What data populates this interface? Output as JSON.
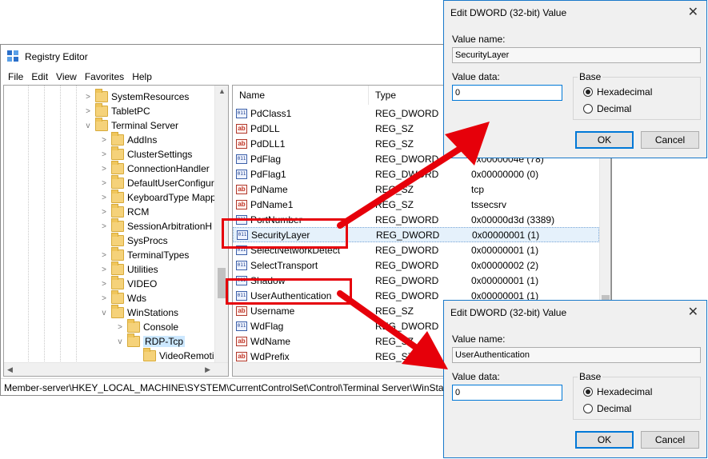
{
  "window": {
    "title": "Registry Editor"
  },
  "menu": [
    "File",
    "Edit",
    "View",
    "Favorites",
    "Help"
  ],
  "tree": {
    "items": [
      {
        "label": "SystemResources",
        "chev": ">"
      },
      {
        "label": "TabletPC",
        "chev": ">"
      },
      {
        "label": "Terminal Server",
        "chev": "v"
      },
      {
        "label": "AddIns",
        "chev": ">"
      },
      {
        "label": "ClusterSettings",
        "chev": ">"
      },
      {
        "label": "ConnectionHandler",
        "chev": ">"
      },
      {
        "label": "DefaultUserConfigur",
        "chev": ">"
      },
      {
        "label": "KeyboardType Mapp",
        "chev": ">"
      },
      {
        "label": "RCM",
        "chev": ">"
      },
      {
        "label": "SessionArbitrationH",
        "chev": ">"
      },
      {
        "label": "SysProcs",
        "chev": ""
      },
      {
        "label": "TerminalTypes",
        "chev": ">"
      },
      {
        "label": "Utilities",
        "chev": ">"
      },
      {
        "label": "VIDEO",
        "chev": ">"
      },
      {
        "label": "Wds",
        "chev": ">"
      },
      {
        "label": "WinStations",
        "chev": "v"
      },
      {
        "label": "Console",
        "chev": ">"
      },
      {
        "label": "RDP-Tcp",
        "chev": "v"
      },
      {
        "label": "VideoRemoti",
        "chev": ""
      }
    ]
  },
  "list": {
    "columns": [
      "Name",
      "Type"
    ],
    "rows": [
      {
        "icon": "binary",
        "name": "PdClass1",
        "type": "REG_DWORD",
        "data": ""
      },
      {
        "icon": "string",
        "name": "PdDLL",
        "type": "REG_SZ",
        "data": ""
      },
      {
        "icon": "string",
        "name": "PdDLL1",
        "type": "REG_SZ",
        "data": ""
      },
      {
        "icon": "binary",
        "name": "PdFlag",
        "type": "REG_DWORD",
        "data": "0x0000004e (78)"
      },
      {
        "icon": "binary",
        "name": "PdFlag1",
        "type": "REG_DWORD",
        "data": "0x00000000 (0)"
      },
      {
        "icon": "string",
        "name": "PdName",
        "type": "REG_SZ",
        "data": "tcp"
      },
      {
        "icon": "string",
        "name": "PdName1",
        "type": "REG_SZ",
        "data": "tssecsrv"
      },
      {
        "icon": "binary",
        "name": "PortNumber",
        "type": "REG_DWORD",
        "data": "0x00000d3d (3389)"
      },
      {
        "icon": "binary",
        "name": "SecurityLayer",
        "type": "REG_DWORD",
        "data": "0x00000001 (1)"
      },
      {
        "icon": "binary",
        "name": "SelectNetworkDetect",
        "type": "REG_DWORD",
        "data": "0x00000001 (1)"
      },
      {
        "icon": "binary",
        "name": "SelectTransport",
        "type": "REG_DWORD",
        "data": "0x00000002 (2)"
      },
      {
        "icon": "binary",
        "name": "Shadow",
        "type": "REG_DWORD",
        "data": "0x00000001 (1)"
      },
      {
        "icon": "binary",
        "name": "UserAuthentication",
        "type": "REG_DWORD",
        "data": "0x00000001 (1)"
      },
      {
        "icon": "string",
        "name": "Username",
        "type": "REG_SZ",
        "data": ""
      },
      {
        "icon": "binary",
        "name": "WdFlag",
        "type": "REG_DWORD",
        "data": ""
      },
      {
        "icon": "string",
        "name": "WdName",
        "type": "REG_SZ",
        "data": ""
      },
      {
        "icon": "string",
        "name": "WdPrefix",
        "type": "REG_SZ",
        "data": ""
      }
    ]
  },
  "statusbar": {
    "path": "Member-server\\HKEY_LOCAL_MACHINE\\SYSTEM\\CurrentControlSet\\Control\\Terminal Server\\WinStatio"
  },
  "dialog1": {
    "title": "Edit DWORD (32-bit) Value",
    "value_name_label": "Value name:",
    "value_name": "SecurityLayer",
    "value_data_label": "Value data:",
    "value_data": "0",
    "base_label": "Base",
    "hex_label": "Hexadecimal",
    "dec_label": "Decimal",
    "ok_label": "OK",
    "cancel_label": "Cancel"
  },
  "dialog2": {
    "title": "Edit DWORD (32-bit) Value",
    "value_name_label": "Value name:",
    "value_name": "UserAuthentication",
    "value_data_label": "Value data:",
    "value_data": "0",
    "base_label": "Base",
    "hex_label": "Hexadecimal",
    "dec_label": "Decimal",
    "ok_label": "OK",
    "cancel_label": "Cancel"
  },
  "icons": {
    "close": "close-icon",
    "folder": "folder-icon",
    "binary": "reg-binary-icon",
    "string": "reg-string-icon"
  },
  "colors": {
    "highlight": "#e6000a",
    "accent": "#0078d7",
    "selection": "#cce8ff"
  }
}
